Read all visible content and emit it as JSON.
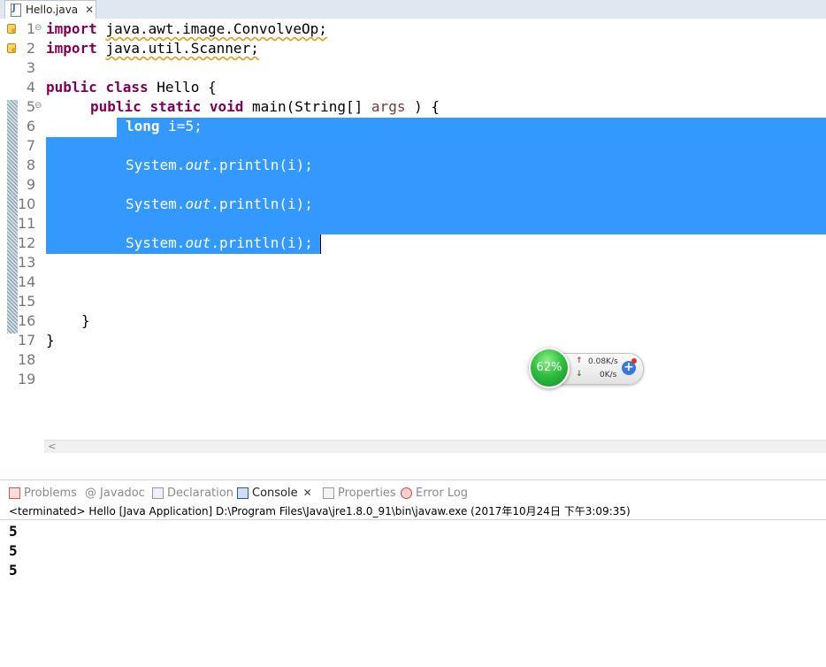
{
  "editor": {
    "tab_label": "Hello.java",
    "tab_close": "✕",
    "line_numbers": [
      "1",
      "2",
      "3",
      "4",
      "5",
      "6",
      "7",
      "8",
      "9",
      "10",
      "11",
      "12",
      "13",
      "14",
      "15",
      "16",
      "17",
      "18",
      "19"
    ],
    "fold_markers": {
      "line1": "⊖",
      "line5": "⊖"
    },
    "lines": {
      "l1": {
        "kw": "import",
        "rest": "java.awt.image.ConvolveOp;"
      },
      "l2": {
        "kw": "import",
        "rest": "java.util.Scanner;"
      },
      "l4": {
        "kw1": "public",
        "kw2": "class",
        "rest": "Hello {"
      },
      "l5": {
        "kw1": "public",
        "kw2": "static",
        "kw3": "void",
        "mid": "main(String[]",
        "var": "args",
        "end": ") {"
      },
      "l6": {
        "kw": "long",
        "rest": "i=5;"
      },
      "l8": {
        "pre": "System.",
        "field": "out",
        "post": ".println(i);"
      },
      "l10": {
        "pre": "System.",
        "field": "out",
        "post": ".println(i);"
      },
      "l12": {
        "pre": "System.",
        "field": "out",
        "post": ".println(i);"
      },
      "l16": "}",
      "l17": "}"
    },
    "scroll_arrow": "<",
    "selection_color": "#3399ff"
  },
  "net_widget": {
    "cpu_percent": "62%",
    "up_speed": "0.08K/s",
    "down_speed": "0K/s",
    "up_arrow": "↑",
    "down_arrow": "↓",
    "plus": "+"
  },
  "panels": {
    "tabs": [
      {
        "label": "Problems"
      },
      {
        "label": "Javadoc"
      },
      {
        "label": "Declaration"
      },
      {
        "label": "Console",
        "active": true
      },
      {
        "label": "Properties"
      },
      {
        "label": "Error Log"
      }
    ],
    "console_close": "✕",
    "console_header": "<terminated> Hello [Java Application] D:\\Program Files\\Java\\jre1.8.0_91\\bin\\javaw.exe (2017年10月24日 下午3:09:35)",
    "output": [
      "5",
      "5",
      "5"
    ]
  }
}
